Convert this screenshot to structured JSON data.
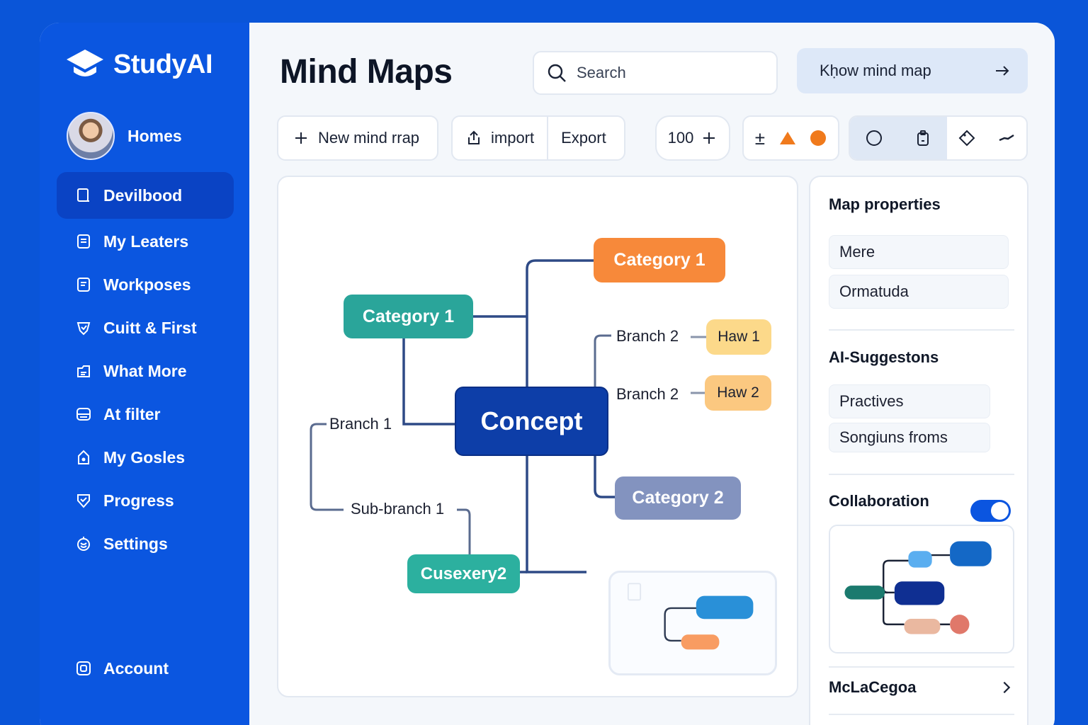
{
  "app": {
    "name": "StudyAI"
  },
  "user": {
    "name": "Homes"
  },
  "sidebar": {
    "items": [
      {
        "label": "Devilbood",
        "icon": "dashboard-icon",
        "active": true
      },
      {
        "label": "My Leaters",
        "icon": "book-icon"
      },
      {
        "label": "Workposes",
        "icon": "book-icon"
      },
      {
        "label": "Cuitt & First",
        "icon": "shield-icon"
      },
      {
        "label": "What More",
        "icon": "folder-icon"
      },
      {
        "label": "At filter",
        "icon": "archive-icon"
      },
      {
        "label": "My Gosles",
        "icon": "lock-icon"
      },
      {
        "label": "Progress",
        "icon": "shield-check-icon"
      },
      {
        "label": "Settings",
        "icon": "gear-icon"
      }
    ],
    "account": {
      "label": "Account",
      "icon": "account-icon"
    }
  },
  "header": {
    "title": "Mind Maps",
    "search_placeholder": "Search",
    "know_button": "Kḥow mind map"
  },
  "toolbar": {
    "new_label": "New mind rrap",
    "import_label": "import",
    "export_label": "Export",
    "zoom_value": "100",
    "shape_symbols": [
      "±"
    ],
    "colors": {
      "triangle": "#f07a1c",
      "circle": "#f07a1c"
    }
  },
  "mindmap": {
    "concept": "Concept",
    "category_orange": "Category 1",
    "category_teal": "Category 1",
    "category_2": "Category 2",
    "cusexery": "Cusexery2",
    "branch_1": "Branch 1",
    "sub_branch_1": "Sub-branch 1",
    "branch_2a": "Branch 2",
    "branch_2b": "Branch 2",
    "haw_1": "Haw 1",
    "haw_2": "Haw 2"
  },
  "panel": {
    "properties_title": "Map properties",
    "properties": [
      "Mere",
      "Ormatuda"
    ],
    "suggestions_title": "AI-Suggestons",
    "suggestions": [
      "Practives",
      "Songiuns froms"
    ],
    "collaboration_label": "Collaboration",
    "collaboration_on": true,
    "footer_label": "McLaCegoa"
  },
  "colors": {
    "brand_blue": "#0b56e0",
    "concept": "#0d3ea8",
    "orange": "#f7893a",
    "teal": "#2aa59a",
    "slate": "#8393bf",
    "yellow": "#fcd98a"
  }
}
